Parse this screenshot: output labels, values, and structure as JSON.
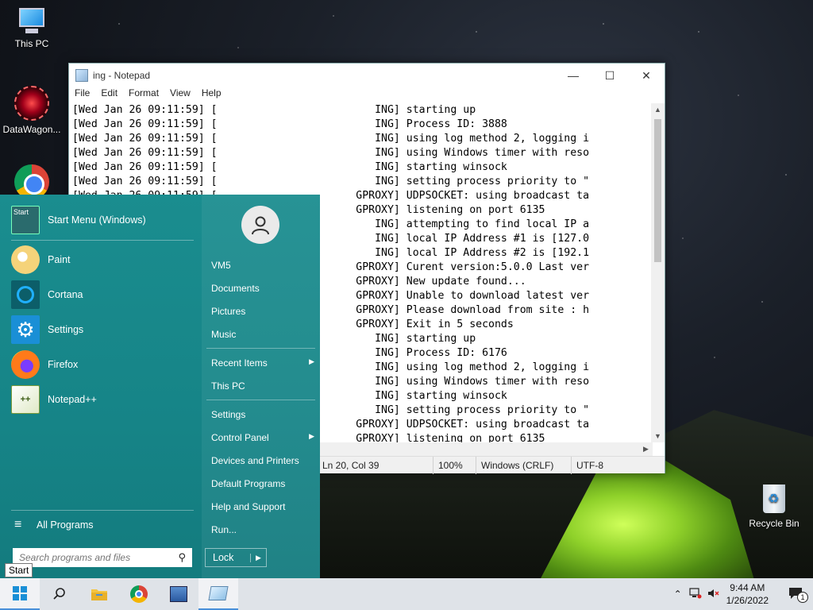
{
  "desktop": {
    "icons": [
      {
        "label": "This PC"
      },
      {
        "label": "DataWagon..."
      },
      {
        "label": "Recycle Bin"
      }
    ]
  },
  "notepad": {
    "title": "ing - Notepad",
    "menu": [
      "File",
      "Edit",
      "Format",
      "View",
      "Help"
    ],
    "lines": [
      "[Wed Jan 26 09:11:59] [                         ING] starting up",
      "[Wed Jan 26 09:11:59] [                         ING] Process ID: 3888",
      "[Wed Jan 26 09:11:59] [                         ING] using log method 2, logging i",
      "[Wed Jan 26 09:11:59] [                         ING] using Windows timer with reso",
      "[Wed Jan 26 09:11:59] [                         ING] starting winsock",
      "[Wed Jan 26 09:11:59] [                         ING] setting process priority to \"",
      "[Wed Jan 26 09:11:59] [                      GPROXY] UDPSOCKET: using broadcast ta",
      "                                             GPROXY] listening on port 6135",
      "                                                ING] attempting to find local IP a",
      "                                                ING] local IP Address #1 is [127.0",
      "                                                ING] local IP Address #2 is [192.1",
      "                                             GPROXY] Curent version:5.0.0 Last ver",
      "                                             GPROXY] New update found...",
      "                                             GPROXY] Unable to download latest ver",
      "                                             GPROXY] Please download from site : h",
      "                                             GPROXY] Exit in 5 seconds",
      "                                                ING] starting up",
      "                                                ING] Process ID: 6176",
      "                                                ING] using log method 2, logging i",
      "                                                ING] using Windows timer with reso",
      "                                                ING] starting winsock",
      "                                                ING] setting process priority to \"",
      "                                             GPROXY] UDPSOCKET: using broadcast ta",
      "                                             GPROXY] listening on port 6135"
    ],
    "status": {
      "position": "Ln 20, Col 39",
      "zoom": "100%",
      "line_ending": "Windows (CRLF)",
      "encoding": "UTF-8"
    }
  },
  "start_menu": {
    "header": {
      "label": "Start Menu (Windows)",
      "icon_text": "Start"
    },
    "apps": [
      {
        "label": "Paint",
        "icon": "paint-icon"
      },
      {
        "label": "Cortana",
        "icon": "cortana-icon"
      },
      {
        "label": "Settings",
        "icon": "settings-gear-icon"
      },
      {
        "label": "Firefox",
        "icon": "firefox-icon"
      },
      {
        "label": "Notepad++",
        "icon": "notepadpp-icon"
      }
    ],
    "all_programs": "All Programs",
    "search_placeholder": "Search programs and files",
    "right": {
      "user": "VM5",
      "items": [
        "Documents",
        "Pictures",
        "Music",
        "Recent Items",
        "This PC",
        "Settings",
        "Control Panel",
        "Devices and Printers",
        "Default Programs",
        "Help and Support",
        "Run..."
      ],
      "lock": "Lock"
    },
    "tooltip": "Start"
  },
  "taskbar": {
    "time": "9:44 AM",
    "date": "1/26/2022",
    "notification_count": "1"
  }
}
